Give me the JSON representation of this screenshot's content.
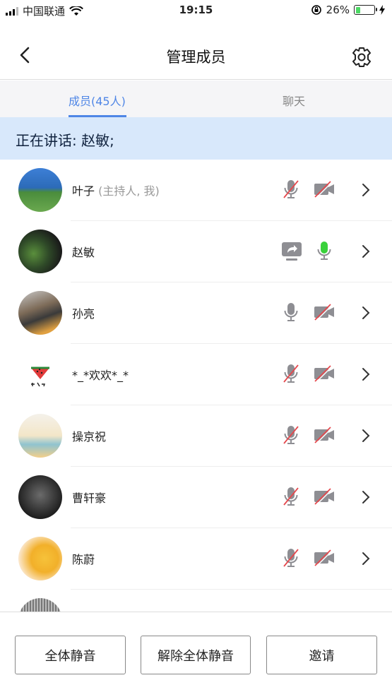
{
  "status_bar": {
    "carrier": "中国联通",
    "time": "19:15",
    "battery": "26%",
    "battery_level": 0.26
  },
  "nav": {
    "title": "管理成员"
  },
  "tabs": [
    {
      "label": "成员(45人)",
      "active": true
    },
    {
      "label": "聊天",
      "active": false
    }
  ],
  "speaking": {
    "text": "正在讲话: 赵敏;"
  },
  "members": [
    {
      "name": "叶子",
      "role": "(主持人, 我)",
      "screen_share": false,
      "mic": "muted",
      "camera": "off"
    },
    {
      "name": "赵敏",
      "role": "",
      "screen_share": true,
      "mic": "active",
      "camera": "none"
    },
    {
      "name": "孙亮",
      "role": "",
      "screen_share": false,
      "mic": "on",
      "camera": "off"
    },
    {
      "name": "*_*欢欢*_*",
      "role": "",
      "screen_share": false,
      "mic": "muted",
      "camera": "off"
    },
    {
      "name": "操京祝",
      "role": "",
      "screen_share": false,
      "mic": "muted",
      "camera": "off"
    },
    {
      "name": "曹轩豪",
      "role": "",
      "screen_share": false,
      "mic": "muted",
      "camera": "off"
    },
    {
      "name": "陈蔚",
      "role": "",
      "screen_share": false,
      "mic": "muted",
      "camera": "off"
    }
  ],
  "footer": {
    "mute_all": "全体静音",
    "unmute_all": "解除全体静音",
    "invite": "邀请"
  },
  "colors": {
    "accent": "#4f86e6",
    "speaking_bg": "#d8e8fb",
    "mic_active": "#39d13b",
    "muted_slash": "#e5484d",
    "icon_gray": "#8e8e93"
  }
}
